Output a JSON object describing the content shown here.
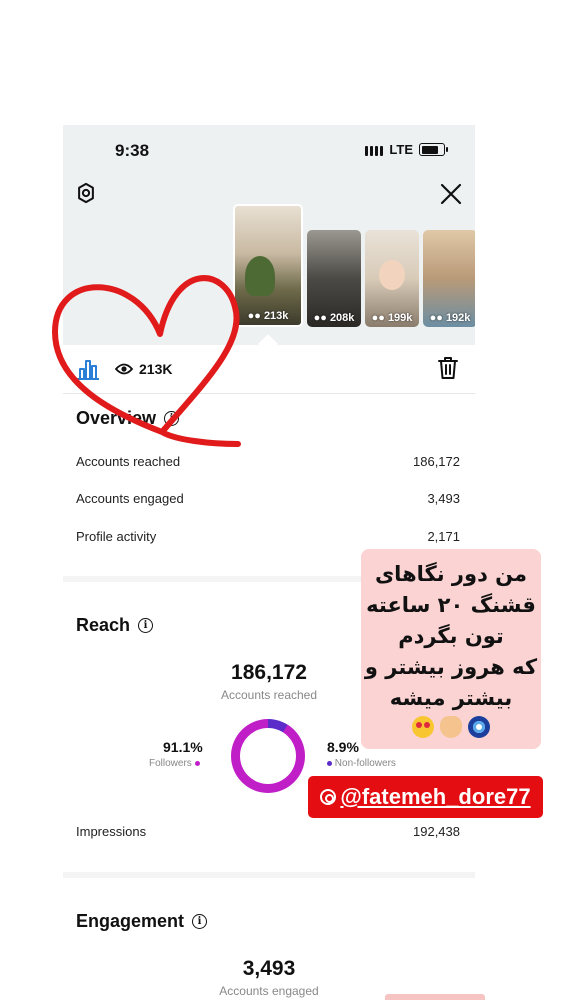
{
  "status": {
    "time": "9:38",
    "network": "LTE"
  },
  "thumbnails": [
    {
      "count": "213k",
      "selected": true
    },
    {
      "count": "208k"
    },
    {
      "count": "199k"
    },
    {
      "count": "192k"
    }
  ],
  "toolbar": {
    "views": "213K"
  },
  "overview": {
    "title": "Overview",
    "rows": [
      {
        "label": "Accounts reached",
        "value": "186,172"
      },
      {
        "label": "Accounts engaged",
        "value": "3,493"
      },
      {
        "label": "Profile activity",
        "value": "2,171"
      }
    ]
  },
  "reach": {
    "title": "Reach",
    "value": "186,172",
    "sub": "Accounts reached",
    "followers_pct": "91.1%",
    "followers_label": "Followers",
    "nonfollowers_pct": "8.9%",
    "nonfollowers_label": "Non-followers",
    "impressions_label": "Impressions",
    "impressions_value": "192,438",
    "colors": {
      "followers": "#c01fc8",
      "nonfollowers": "#5b2cc9"
    }
  },
  "engagement": {
    "title": "Engagement",
    "value": "3,493",
    "sub": "Accounts engaged"
  },
  "sticker": {
    "lines": [
      "من دور نگاهای",
      "قشنگ ۲۰ ساعته",
      "تون بگردم",
      "که هروز بیشتر و",
      "بیشتر میشه"
    ],
    "emojis": [
      "nazar-amulet-icon",
      "heart-hands-icon",
      "heart-eyes-face-icon"
    ]
  },
  "mention": {
    "handle": "@fatemeh_dore77"
  },
  "colors": {
    "heart": "#e11b1b",
    "sticker_bg": "#fbd3d3",
    "mention_bg": "#e30d12",
    "accent_blue": "#2b7fd6"
  }
}
